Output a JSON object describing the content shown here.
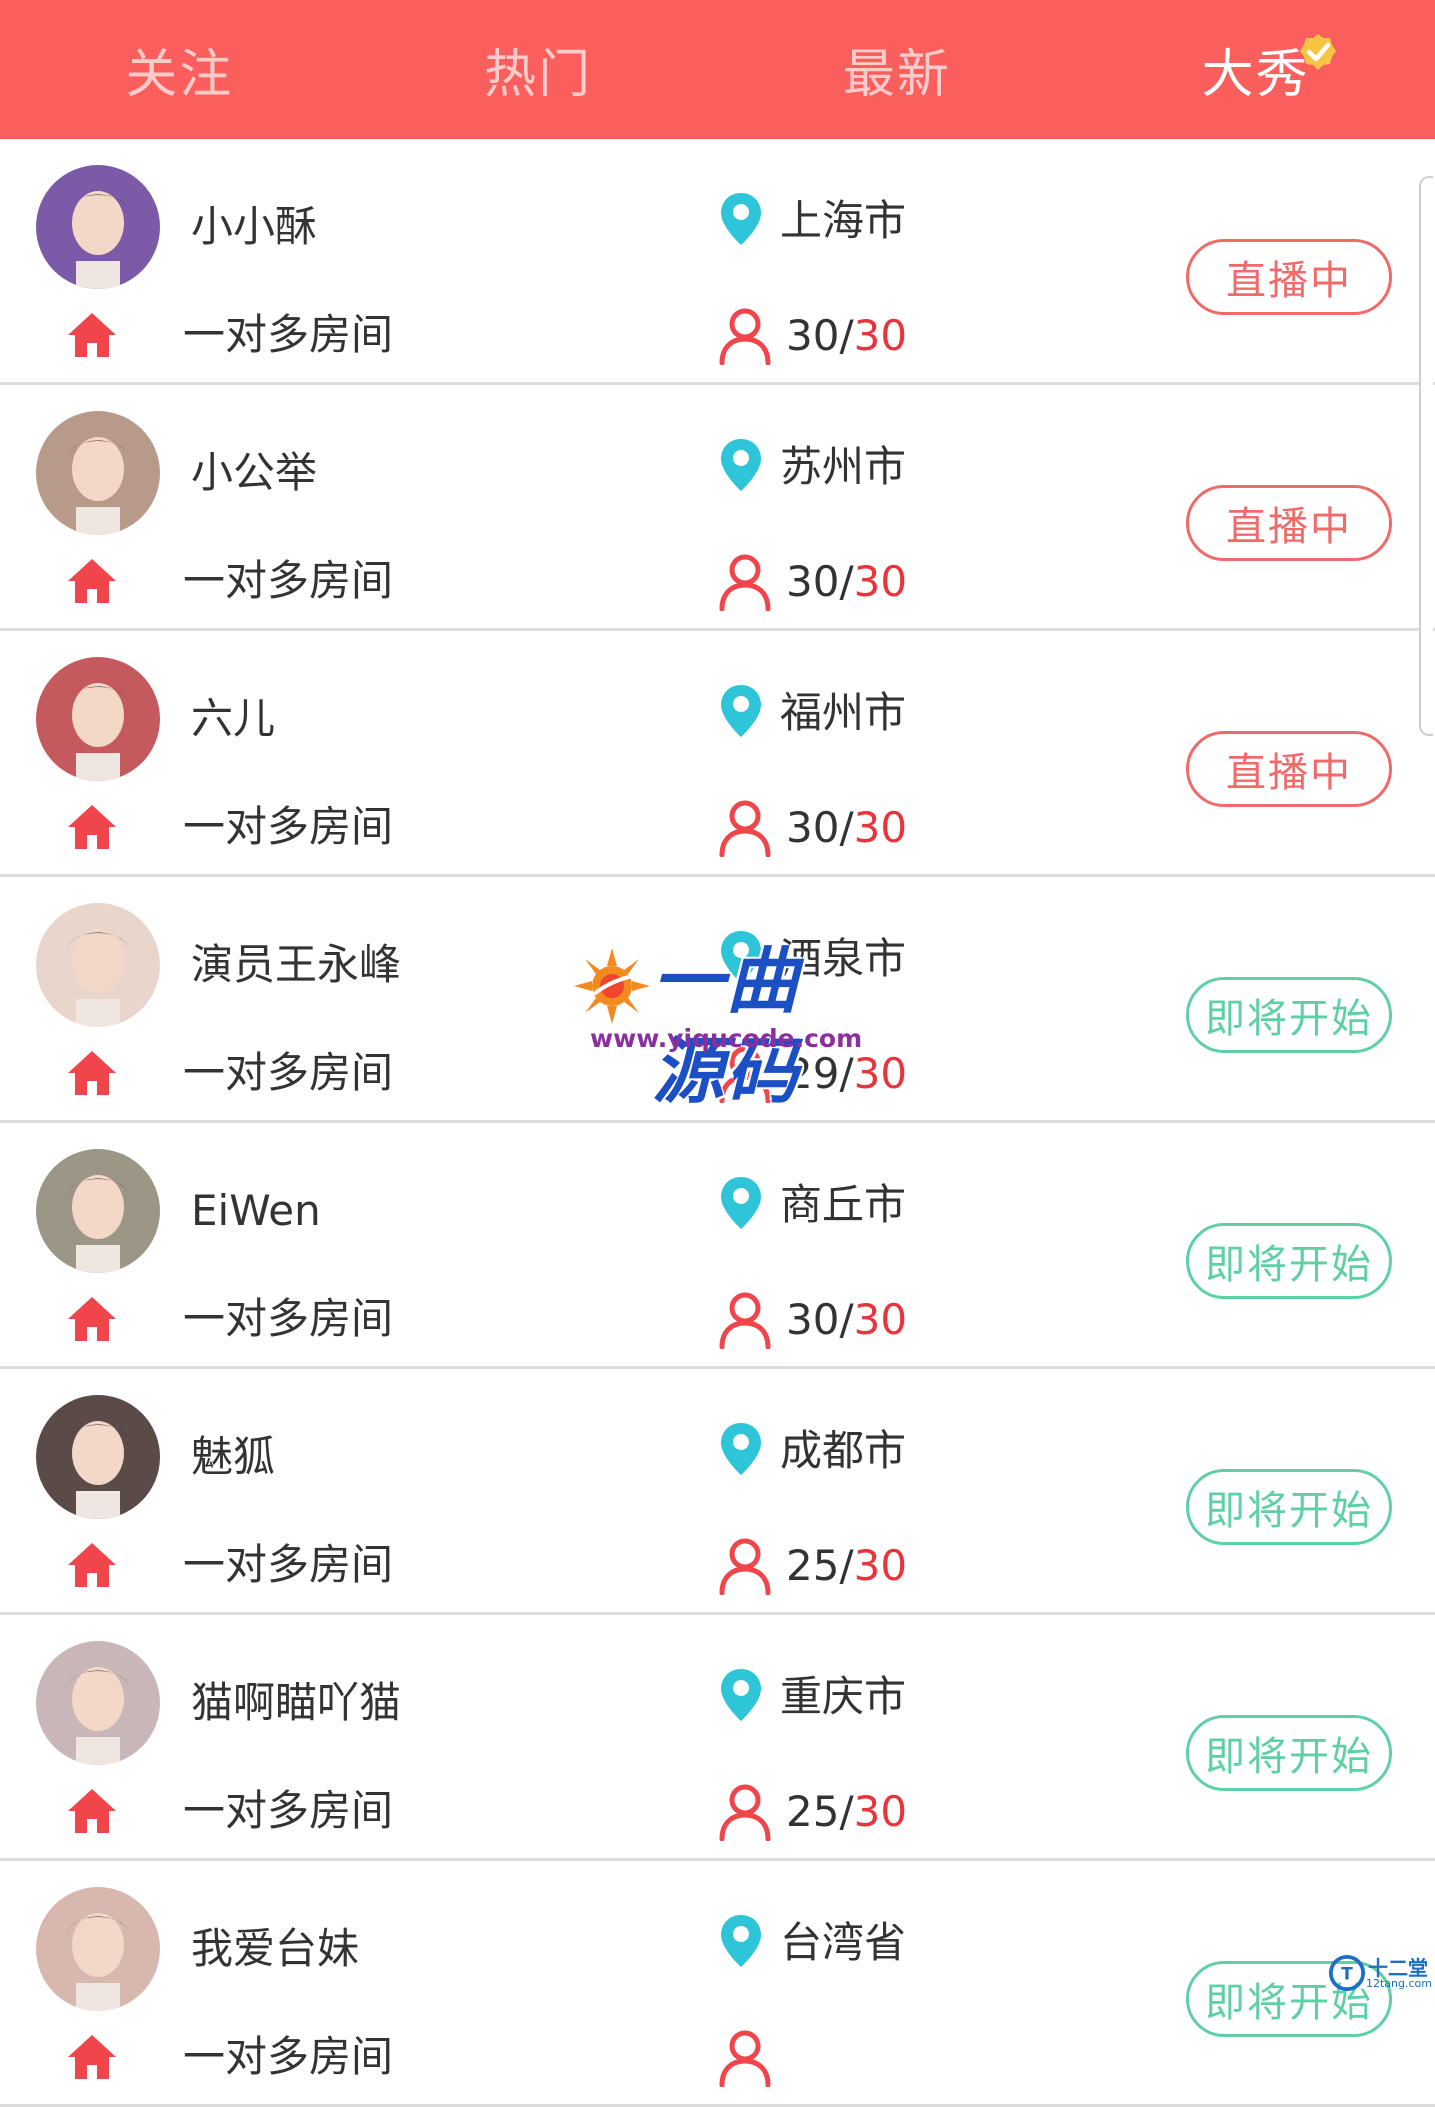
{
  "tabs": [
    {
      "label": "关注",
      "active": false
    },
    {
      "label": "热门",
      "active": false
    },
    {
      "label": "最新",
      "active": false
    },
    {
      "label": "大秀",
      "active": true
    }
  ],
  "colors": {
    "header": "#fa5f5e",
    "live": "#f06a6a",
    "soon": "#5fd0a6",
    "pin": "#2ec5d9",
    "home": "#f0454a",
    "capacity": "#e8353b"
  },
  "rooms": [
    {
      "name": "小小酥",
      "city": "上海市",
      "room_type": "一对多房间",
      "current": "30",
      "separator": "/",
      "capacity": "30",
      "status": "直播中",
      "state": "live",
      "avatar_color": "#7b5aa8"
    },
    {
      "name": "小公举",
      "city": "苏州市",
      "room_type": "一对多房间",
      "current": "30",
      "separator": "/",
      "capacity": "30",
      "status": "直播中",
      "state": "live",
      "avatar_color": "#b89a8a"
    },
    {
      "name": "六儿",
      "city": "福州市",
      "room_type": "一对多房间",
      "current": "30",
      "separator": "/",
      "capacity": "30",
      "status": "直播中",
      "state": "live",
      "avatar_color": "#c45a5e"
    },
    {
      "name": "演员王永峰",
      "city": "酒泉市",
      "room_type": "一对多房间",
      "current": "29",
      "separator": "/",
      "capacity": "30",
      "status": "即将开始",
      "state": "soon",
      "avatar_color": "#e8d6cc"
    },
    {
      "name": "EiWen",
      "city": "商丘市",
      "room_type": "一对多房间",
      "current": "30",
      "separator": "/",
      "capacity": "30",
      "status": "即将开始",
      "state": "soon",
      "avatar_color": "#9b9685"
    },
    {
      "name": "魅狐",
      "city": "成都市",
      "room_type": "一对多房间",
      "current": "25",
      "separator": "/",
      "capacity": "30",
      "status": "即将开始",
      "state": "soon",
      "avatar_color": "#5a4a48"
    },
    {
      "name": "猫啊瞄吖猫",
      "city": "重庆市",
      "room_type": "一对多房间",
      "current": "25",
      "separator": "/",
      "capacity": "30",
      "status": "即将开始",
      "state": "soon",
      "avatar_color": "#c9b6b8"
    },
    {
      "name": "我爱台妹",
      "city": "台湾省",
      "room_type": "一对多房间",
      "current": "",
      "separator": "",
      "capacity": "",
      "status": "即将开始",
      "state": "soon",
      "avatar_color": "#d8b8ae"
    }
  ],
  "watermark": {
    "title": "一曲源码",
    "url": "www.yiqucode.com"
  },
  "corner_logo": {
    "title": "十二堂",
    "url": "12tang.com"
  }
}
